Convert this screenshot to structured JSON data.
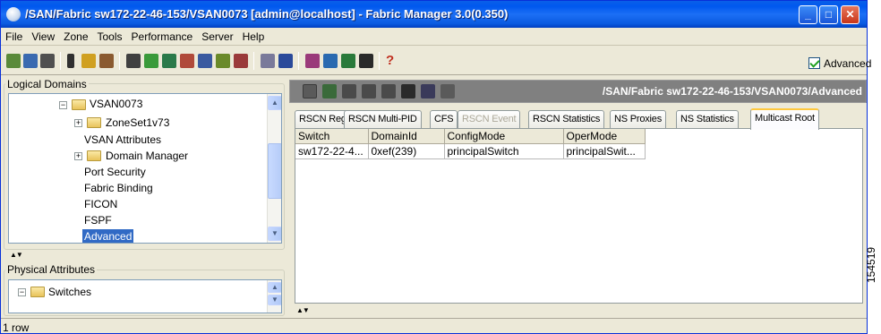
{
  "window": {
    "title": "/SAN/Fabric sw172-22-46-153/VSAN0073 [admin@localhost] - Fabric Manager 3.0(0.350)",
    "buttons": [
      "minimize",
      "maximize",
      "close"
    ]
  },
  "menu": [
    "File",
    "View",
    "Zone",
    "Tools",
    "Performance",
    "Server",
    "Help"
  ],
  "toolbar": {
    "icons": [
      "open-icon",
      "discover-icon",
      "search-icon",
      "bar-icon",
      "lock-icon",
      "chart-icon",
      "port-icon",
      "network-icon",
      "switch-icon",
      "config-icon",
      "device-icon",
      "users-icon",
      "table-icon",
      "zone-icon",
      "view-icon",
      "fabric-icon",
      "tools-icon",
      "monitor-icon",
      "help-icon"
    ],
    "advanced_label": "Advanced",
    "advanced_checked": true
  },
  "logical_domains": {
    "title": "Logical Domains",
    "nodes": [
      {
        "label": "VSAN0073",
        "expander": "⊟",
        "folder": true
      },
      {
        "label": "ZoneSet1v73",
        "expander": "⊞",
        "folder": true
      },
      {
        "label": "VSAN Attributes"
      },
      {
        "label": "Domain Manager",
        "expander": "⊞",
        "folder": true
      },
      {
        "label": "Port Security"
      },
      {
        "label": "Fabric Binding"
      },
      {
        "label": "FICON"
      },
      {
        "label": "FSPF"
      },
      {
        "label": "Advanced",
        "selected": true
      }
    ]
  },
  "physical_attributes": {
    "title": "Physical Attributes",
    "nodes": [
      {
        "label": "Switches",
        "expander": "⊟",
        "folder": true
      }
    ]
  },
  "right_panel": {
    "path": "/SAN/Fabric sw172-22-46-153/VSAN0073/Advanced",
    "tabs": [
      {
        "label": "RSCN Reg"
      },
      {
        "label": "RSCN Multi-PID"
      },
      {
        "label": "CFS"
      },
      {
        "label": "RSCN Event",
        "disabled": true
      },
      {
        "label": "RSCN Statistics"
      },
      {
        "label": "NS Proxies"
      },
      {
        "label": "NS Statistics"
      },
      {
        "label": "Multicast Root",
        "active": true
      }
    ],
    "table": {
      "columns": [
        "Switch",
        "DomainId",
        "ConfigMode",
        "OperMode"
      ],
      "rows": [
        [
          "sw172-22-4...",
          "0xef(239)",
          "principalSwitch",
          "principalSwit..."
        ]
      ]
    }
  },
  "status": "1 row",
  "side_id": "154519"
}
